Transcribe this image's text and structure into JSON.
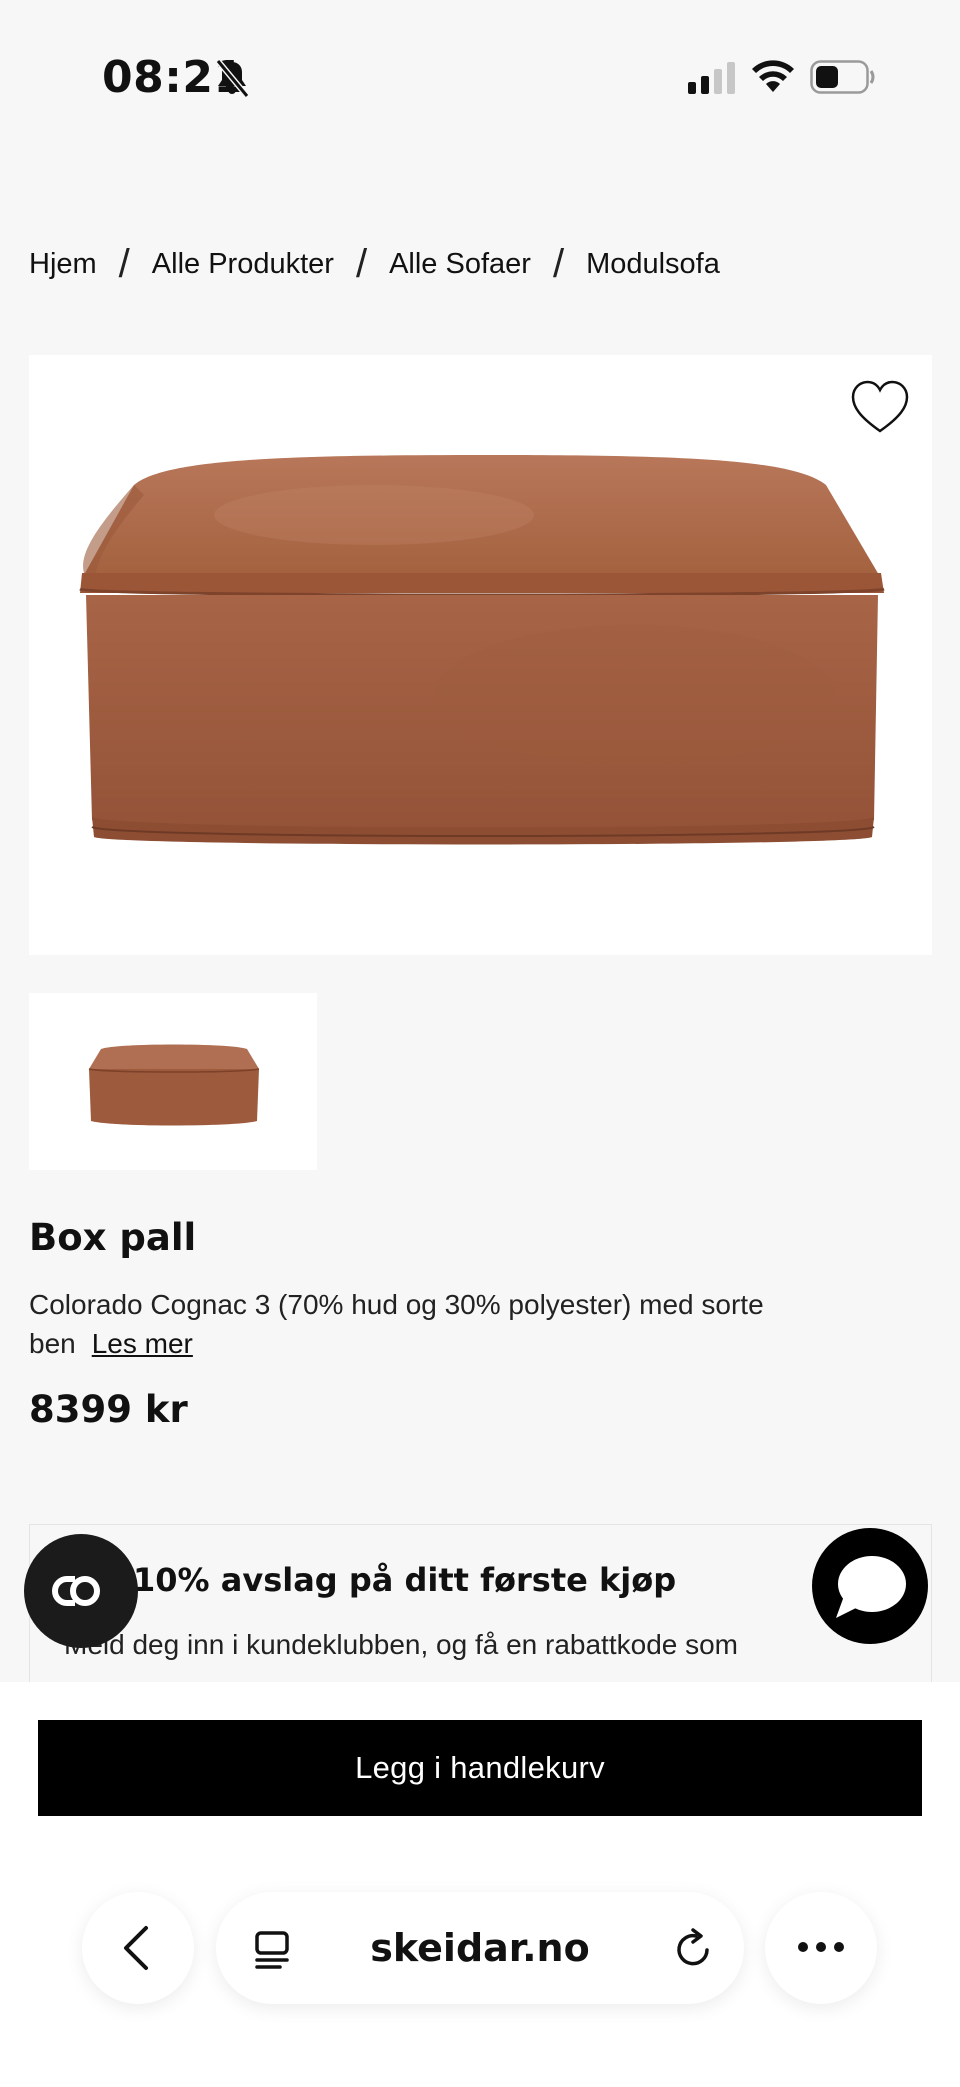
{
  "status_bar": {
    "time": "08:21",
    "icons": [
      "bell-off-icon",
      "signal-icon",
      "wifi-icon",
      "battery-icon"
    ]
  },
  "breadcrumb": {
    "items": [
      "Hjem",
      "Alle Produkter",
      "Alle Sofaer",
      "Modulsofa"
    ],
    "separator": "/"
  },
  "product": {
    "title": "Box pall",
    "description": "Colorado Cognac 3 (70% hud og 30% polyester) med sorte ben",
    "read_more": "Les mer",
    "price": "8399 kr",
    "colors": {
      "leather": "#a8664a",
      "leather_dark": "#8a4f37"
    }
  },
  "promo": {
    "title": "10% avslag på ditt første kjøp",
    "text": "Meld deg inn i kundeklubben, og få en rabattkode som"
  },
  "cart_button": {
    "label": "Legg i handlekurv"
  },
  "browser": {
    "url": "skeidar.no"
  }
}
